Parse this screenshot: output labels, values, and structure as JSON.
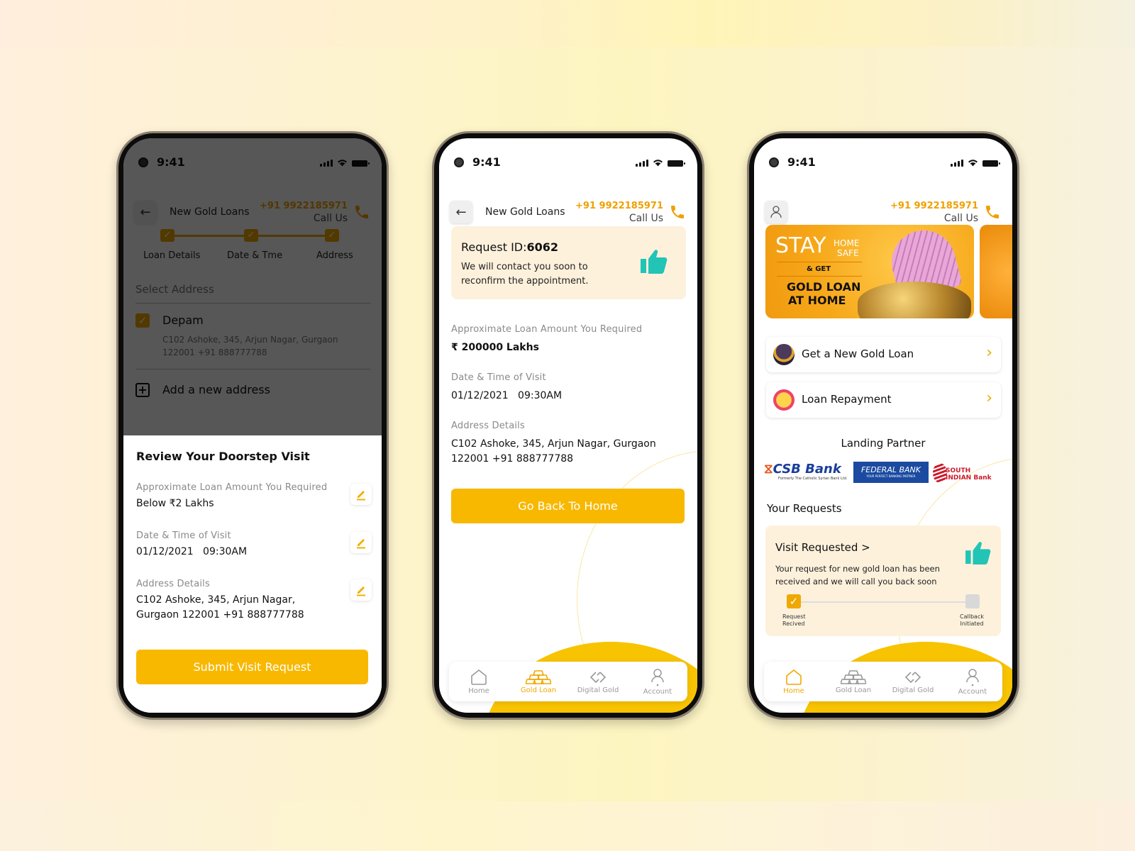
{
  "status_bar": {
    "time": "9:41"
  },
  "header": {
    "title": "New Gold Loans",
    "phone": "+91 9922185971",
    "call_label": "Call Us"
  },
  "screen1": {
    "steps": [
      {
        "label": "Loan Details",
        "done": true
      },
      {
        "label": "Date & Tme",
        "done": true
      },
      {
        "label": "Address",
        "done": true
      }
    ],
    "select_address_label": "Select Address",
    "address": {
      "name": "Depam",
      "checked": true,
      "line1": "C102 Ashoke, 345, Arjun Nagar, Gurgaon",
      "line2": "122001 +91 888777788"
    },
    "add_address_label": "Add a new address",
    "review": {
      "title": "Review Your Doorstep Visit",
      "loan_label": "Approximate Loan Amount You Required",
      "loan_value": "Below ₹2 Lakhs",
      "date_label": "Date & Time of Visit",
      "date_value": "01/12/2021   09:30AM",
      "address_label": "Address Details",
      "address_line1": "C102 Ashoke, 345, Arjun Nagar,",
      "address_line2": "Gurgaon 122001 +91 888777788",
      "submit_label": "Submit Visit Request"
    }
  },
  "screen2": {
    "request_prefix": "Request ID:",
    "request_id": "6062",
    "request_msg_line1": "We will contact you soon to",
    "request_msg_line2": "reconfirm the appointment.",
    "loan_label": "Approximate Loan Amount You Required",
    "loan_value": "₹ 200000 Lakhs",
    "date_label": "Date & Time of Visit",
    "date_value": "01/12/2021   09:30AM",
    "address_label": "Address Details",
    "address_line1": "C102 Ashoke, 345, Arjun Nagar, Gurgaon",
    "address_line2": "122001 +91 888777788",
    "home_button": "Go Back To Home"
  },
  "screen3": {
    "banner": {
      "stay": "STAY",
      "home": "HOME",
      "safe": "SAFE",
      "get": "& GET",
      "line1": "GOLD LOAN",
      "line2": "AT HOME"
    },
    "menu": [
      {
        "label": "Get a New Gold Loan",
        "icon": "gold-jewel-icon"
      },
      {
        "label": "Loan Repayment",
        "icon": "repayment-icon"
      }
    ],
    "partner_title": "Landing Partner",
    "partners": [
      {
        "name": "CSB Bank",
        "tagline": "Formerly The Catholic Syrian Bank Ltd."
      },
      {
        "name": "FEDERAL BANK",
        "tagline": "YOUR PERFECT BANKING PARTNER"
      },
      {
        "name": "SOUTH INDIAN Bank"
      }
    ],
    "requests_title": "Your Requests",
    "request_card": {
      "title": "Visit Requested >",
      "msg_line1": "Your request for new gold loan has been",
      "msg_line2": "received and we will call you back soon",
      "steps": [
        {
          "label_line1": "Request",
          "label_line2": "Recived",
          "done": true
        },
        {
          "label_line1": "Callback",
          "label_line2": "Initiated",
          "done": false
        }
      ]
    }
  },
  "nav": {
    "items": [
      {
        "label": "Home",
        "icon": "home-icon"
      },
      {
        "label": "Gold Loan",
        "icon": "gold-bars-icon"
      },
      {
        "label": "Digital Gold",
        "icon": "digital-gold-icon"
      },
      {
        "label": "Account",
        "icon": "account-icon"
      }
    ],
    "active_screen2": "Gold Loan",
    "active_screen3": "Home"
  },
  "colors": {
    "accent": "#f8b800",
    "phone_orange": "#f0a000",
    "teal": "#22c4b6",
    "card_bg": "#fdf1dc"
  }
}
